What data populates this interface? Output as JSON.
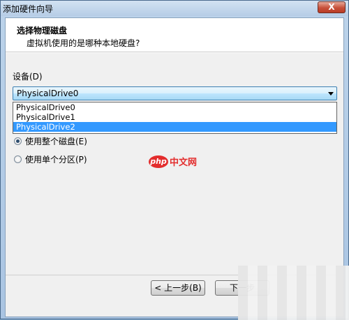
{
  "window": {
    "title": "添加硬件向导",
    "close_label": "X"
  },
  "header": {
    "title": "选择物理磁盘",
    "subtitle": "虚拟机使用的是哪种本地硬盘?"
  },
  "device": {
    "label": "设备(D)",
    "selected": "PhysicalDrive0",
    "options": [
      "PhysicalDrive0",
      "PhysicalDrive1",
      "PhysicalDrive2"
    ],
    "highlighted_index": 2
  },
  "usage": {
    "options": [
      {
        "label": "使用整个磁盘(E)",
        "checked": true
      },
      {
        "label": "使用单个分区(P)",
        "checked": false
      }
    ]
  },
  "watermark": {
    "badge": "php",
    "text": "中文网"
  },
  "buttons": {
    "back": "< 上一步(B)",
    "next": "下一步"
  },
  "colors": {
    "accent": "#3399ff",
    "watermark": "#e32d2d",
    "close": "#c7503a"
  }
}
